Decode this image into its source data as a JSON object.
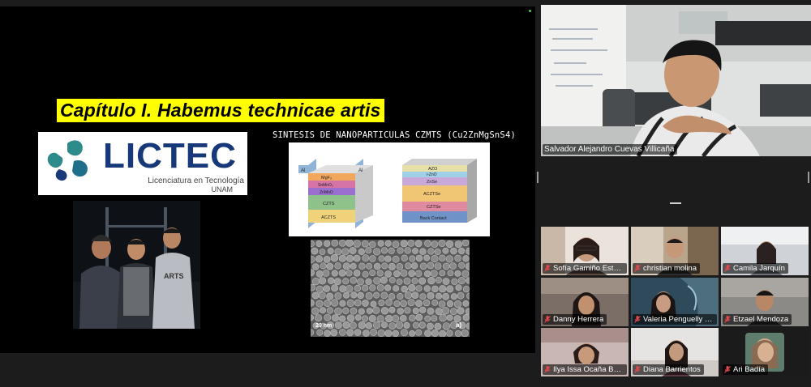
{
  "shared_screen": {
    "slide_title": "Capítulo I. Habemus technicae artis",
    "logo": {
      "wordmark": "LICTEC",
      "subtitle_line1": "Licenciatura en Tecnología",
      "subtitle_line2": "UNAM"
    },
    "synthesis_title": "SINTESIS DE NANOPARTICULAS CZMTS (Cu2ZnMgSnS4)",
    "cell_left_layers": [
      "MgF₂",
      "SnMnO₂",
      "ZnMnO",
      "CZTS",
      "ACZTS"
    ],
    "cell_left_contacts": [
      "Al",
      "Al"
    ],
    "cell_right_layers": [
      "AZO",
      "i-ZnO",
      "ZnSe",
      "ACZTSe",
      "CZTSe",
      "Back Contact"
    ],
    "sem_scale": "20 nm",
    "sem_panel": "a)"
  },
  "speaker": {
    "name": "Salvador Alejandro Cuevas Villicaña"
  },
  "participants": [
    {
      "name": "Sofía Gamiño Estrada"
    },
    {
      "name": "christian molina"
    },
    {
      "name": "Camila Jarquín"
    },
    {
      "name": "Danny Herrera"
    },
    {
      "name": "Valeria Penguelly Zun..."
    },
    {
      "name": "Etzael Mendoza"
    },
    {
      "name": "Ilya Issa Ocaña Benitez"
    },
    {
      "name": "Diana Barrientos"
    },
    {
      "name": "Ari Badía"
    }
  ],
  "colors": {
    "title_highlight": "#ffff00",
    "logo_text": "#17397a",
    "mic_muted": "#e5484d",
    "recording_dot": "#3ecf5a"
  }
}
